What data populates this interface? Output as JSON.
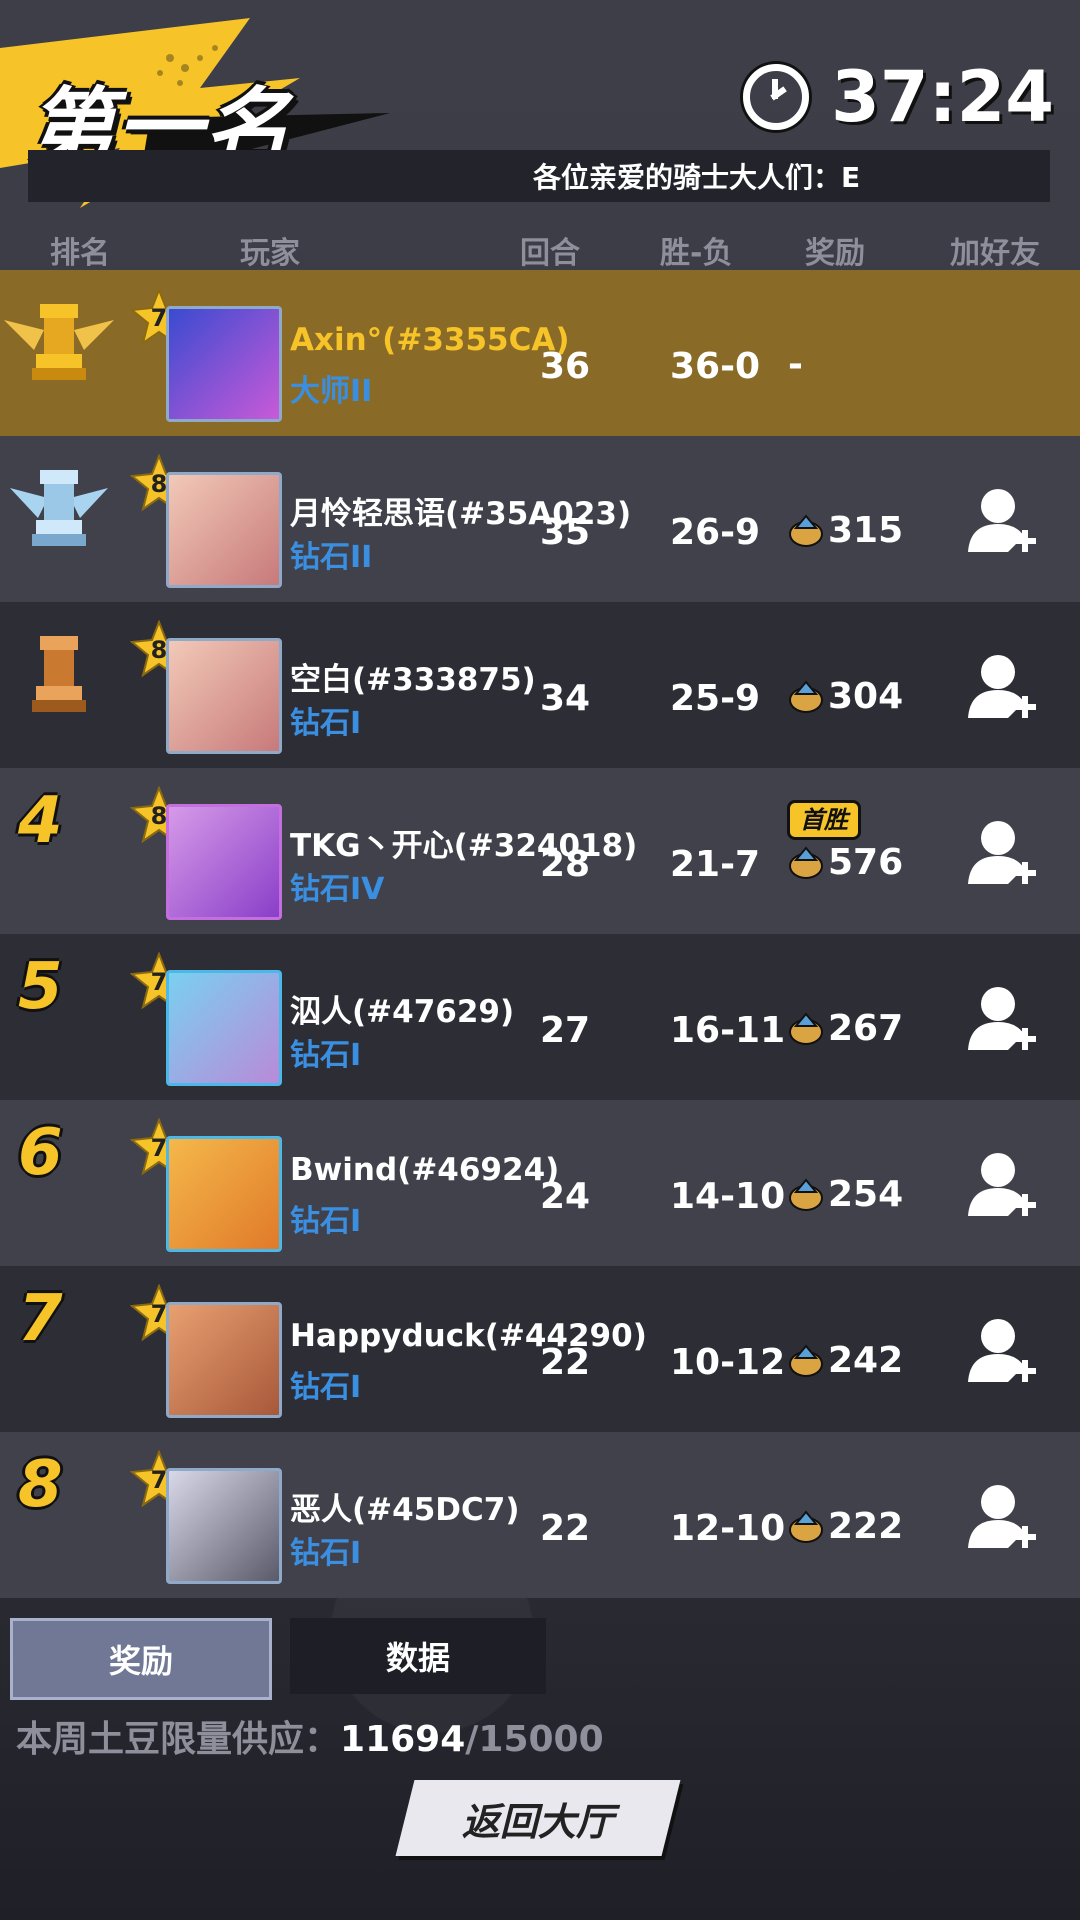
{
  "header": {
    "title": "第一名",
    "timer": "37:24",
    "marquee": "各位亲爱的骑士大人们：E"
  },
  "columns": {
    "rank": "排名",
    "player": "玩家",
    "rounds": "回合",
    "win_loss": "胜-负",
    "reward": "奖励",
    "add_friend": "加好友"
  },
  "players": [
    {
      "rank": "1",
      "level": "7",
      "name": "Axin°(#3355CA)",
      "tier": "大师II",
      "rounds": "36",
      "wl": "36-0",
      "reward": "-",
      "first_win": "",
      "is_me": true
    },
    {
      "rank": "2",
      "level": "8",
      "name": "月怜轻思语(#35A023)",
      "tier": "钻石II",
      "rounds": "35",
      "wl": "26-9",
      "reward": "315",
      "first_win": ""
    },
    {
      "rank": "3",
      "level": "8",
      "name": "空白(#333875)",
      "tier": "钻石I",
      "rounds": "34",
      "wl": "25-9",
      "reward": "304",
      "first_win": ""
    },
    {
      "rank": "4",
      "level": "8",
      "name": "TKG丶开心(#324018)",
      "tier": "钻石IV",
      "rounds": "28",
      "wl": "21-7",
      "reward": "576",
      "first_win": "首胜"
    },
    {
      "rank": "5",
      "level": "7",
      "name": "泅人(#47629)",
      "tier": "钻石I",
      "rounds": "27",
      "wl": "16-11",
      "reward": "267",
      "first_win": ""
    },
    {
      "rank": "6",
      "level": "7",
      "name": "Bwind(#46924)",
      "tier": "钻石I",
      "rounds": "24",
      "wl": "14-10",
      "reward": "254",
      "first_win": ""
    },
    {
      "rank": "7",
      "level": "7",
      "name": "Happyduck(#44290)",
      "tier": "钻石I",
      "rounds": "22",
      "wl": "10-12",
      "reward": "242",
      "first_win": ""
    },
    {
      "rank": "8",
      "level": "7",
      "name": "恶人(#45DC7)",
      "tier": "钻石I",
      "rounds": "22",
      "wl": "12-10",
      "reward": "222",
      "first_win": ""
    }
  ],
  "tabs": {
    "rewards": "奖励",
    "data": "数据"
  },
  "supply": {
    "label": "本周土豆限量供应：",
    "current": "11694",
    "max": "/15000"
  },
  "back_button": "返回大厅",
  "colors": {
    "accent_yellow": "#f6c428",
    "tier_blue": "#3a8fe0",
    "highlight_row": "#8a6a27"
  }
}
